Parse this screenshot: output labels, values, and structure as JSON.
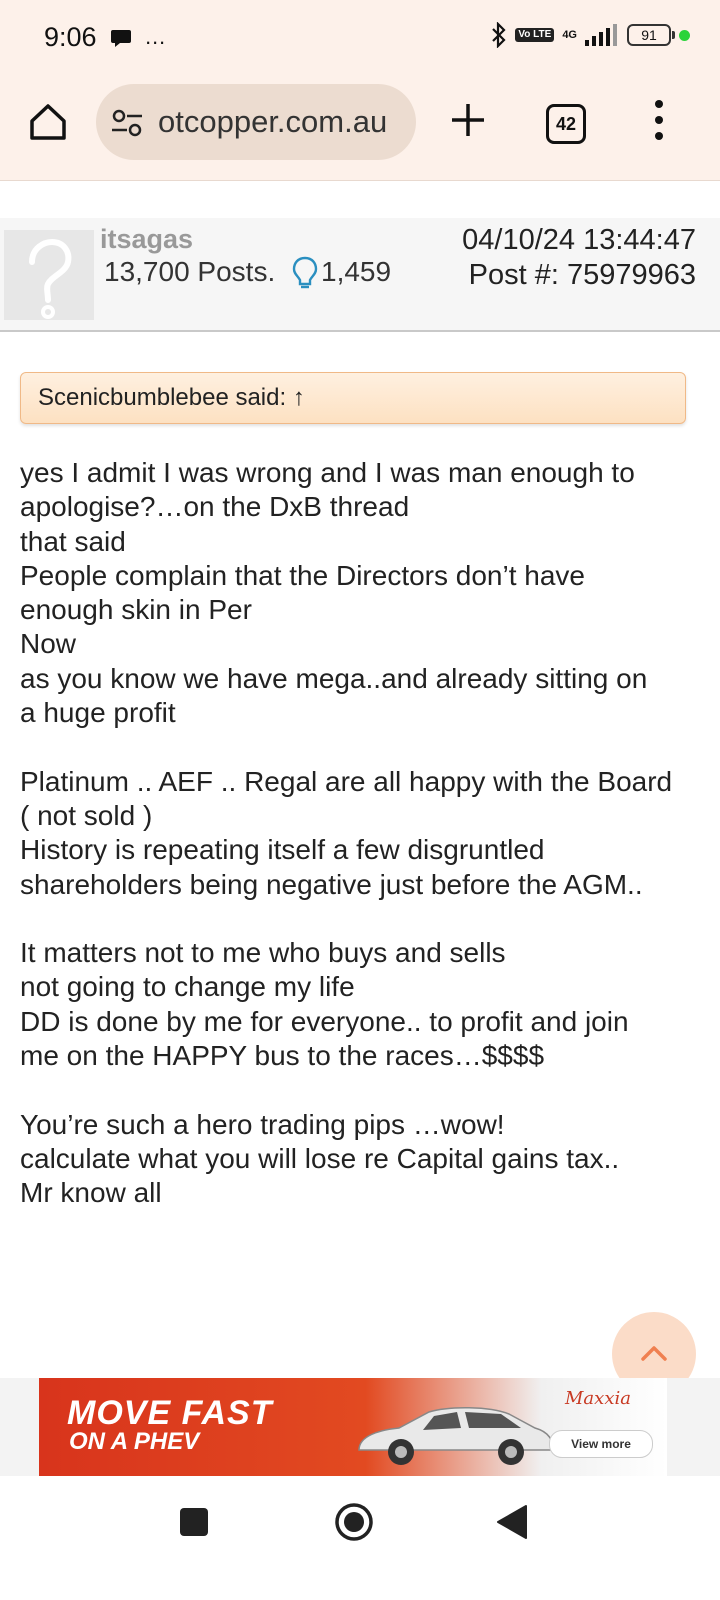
{
  "status_bar": {
    "time": "9:06",
    "left_icons": "…",
    "network": "4G",
    "volte": "Vo LTE",
    "battery": "91"
  },
  "browser": {
    "url": "otcopper.com.au",
    "tab_count": "42"
  },
  "post": {
    "username": "itsagas",
    "posts_count": "13,700 Posts.",
    "likes": "1,459",
    "date": "04/10/24  13:44:47",
    "post_number": "Post #:  75979963",
    "quote": "Scenicbumblebee said: ↑",
    "lines": [
      "yes I admit I was wrong and I was man enough to",
      "apologise?…on the DxB thread",
      "that said",
      "People complain that the Directors don’t have",
      "enough skin in Per",
      "Now",
      "as you know we have mega..and already sitting on",
      "a huge profit",
      "",
      "Platinum .. AEF .. Regal are all happy with the Board",
      "( not sold )",
      "History is repeating itself a few disgruntled",
      "shareholders being negative just before the AGM..",
      "",
      "It matters not to me who buys and sells",
      "not going to change my life",
      "DD is done by me for everyone.. to profit and join",
      "me on the HAPPY bus to the races…$$$$",
      "",
      "You’re such a hero trading pips …wow!",
      "calculate what you will lose re Capital gains tax..",
      "Mr know all"
    ]
  },
  "ad": {
    "line1": "MOVE FAST",
    "line2": "ON A PHEV",
    "brand": "Maxxia",
    "cta": "View more"
  },
  "icons": {
    "home": "home-icon",
    "site_settings": "tune-icon",
    "new_tab": "plus-icon",
    "tabs": "tabs-icon",
    "menu": "more-vert-icon",
    "reputation": "lightbulb-icon",
    "scroll_top": "chevron-up-icon"
  },
  "colors": {
    "chrome_bg": "#fdf1ea",
    "url_pill": "#ecdcd0",
    "quote_border": "#f0b987",
    "ad_red": "#d8341c",
    "scroll_btn": "#fbdcc8",
    "accent_orange": "#f08050"
  }
}
